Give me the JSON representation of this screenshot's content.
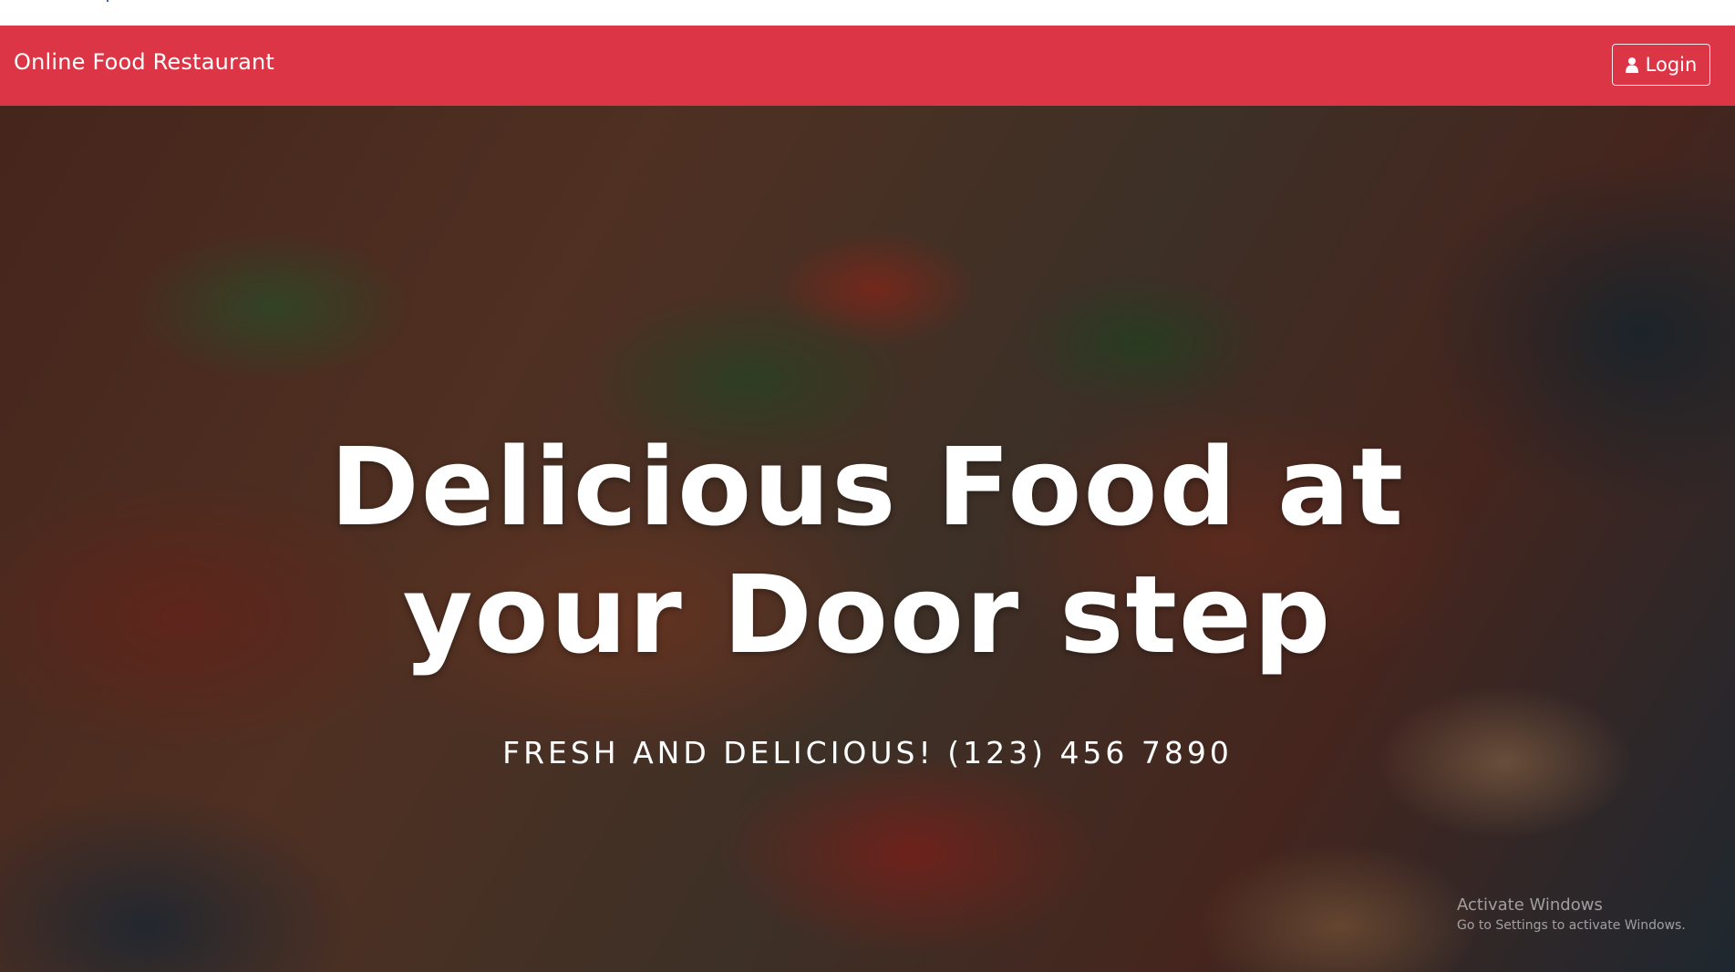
{
  "navbar": {
    "brand": "Online Food Restaurant",
    "login_label": "Login",
    "login_icon": "user-icon",
    "background_color": "#dc3545"
  },
  "hero": {
    "title_line1": "Delicious Food at",
    "title_line2": "your Door step",
    "subtitle": "FRESH AND DELICIOUS! (123) 456 7890"
  },
  "windows_watermark": {
    "title": "Activate Windows",
    "subtitle": "Go to Settings to activate Windows."
  }
}
